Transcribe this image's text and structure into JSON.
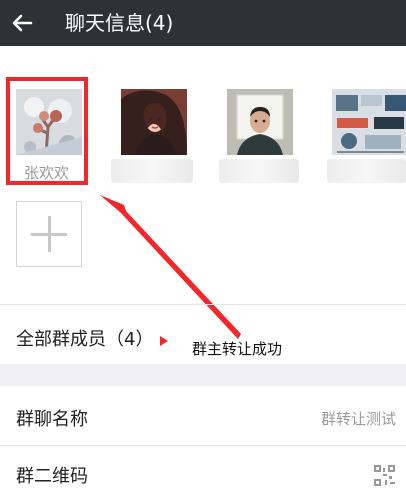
{
  "header": {
    "title": "聊天信息(4)",
    "back_icon": "back-arrow-icon"
  },
  "members": [
    {
      "name": "张欢欢",
      "highlighted": true
    },
    {
      "name": "",
      "highlighted": false
    },
    {
      "name": "",
      "highlighted": false
    },
    {
      "name": "",
      "highlighted": false
    }
  ],
  "add_member_icon": "plus-icon",
  "rows": {
    "all_members_label": "全部群成员（4）",
    "group_name_label": "群聊名称",
    "group_name_value": "群转让测试",
    "qr_label": "群二维码",
    "qr_icon": "qr-code-icon"
  },
  "annotation": {
    "text": "群主转让成功",
    "color": "#f2262b"
  },
  "colors": {
    "header_bg": "#2e3237",
    "accent_red": "#f2262b"
  }
}
